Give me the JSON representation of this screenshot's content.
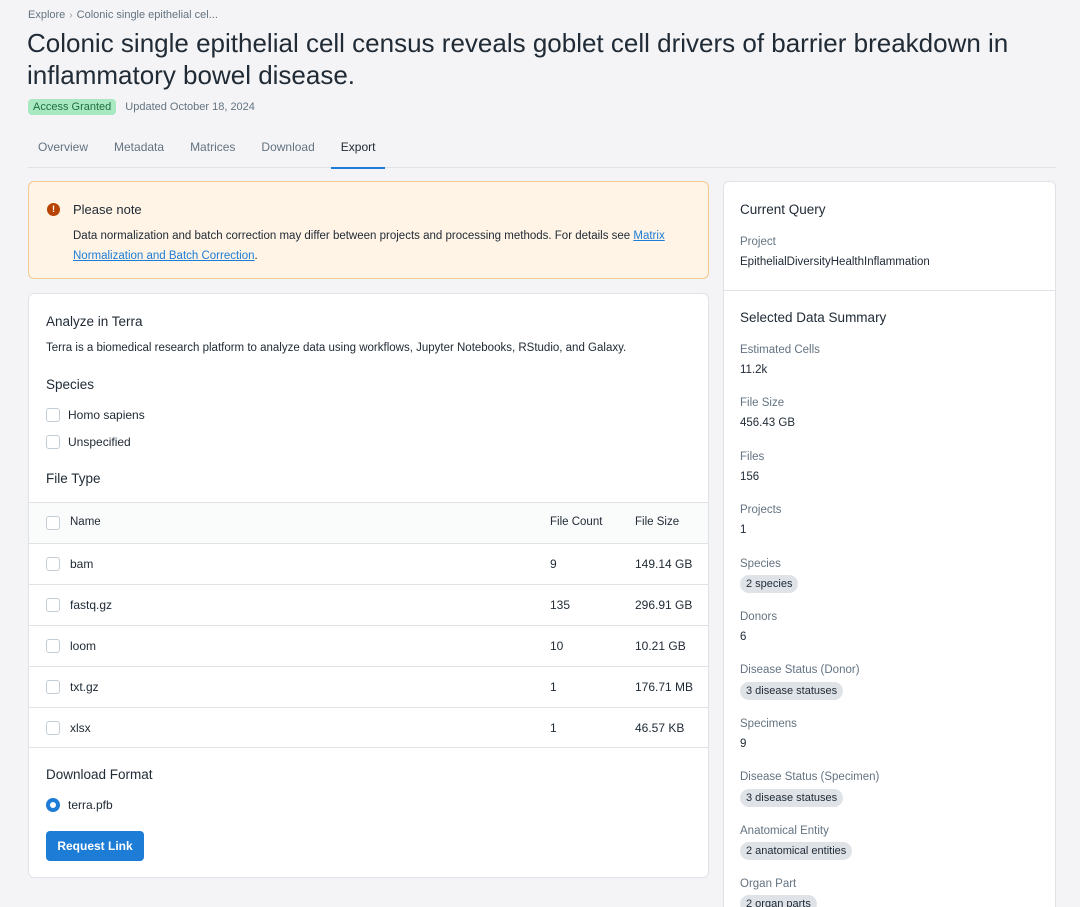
{
  "breadcrumb": {
    "root": "Explore",
    "separator": "›",
    "current": "Colonic single epithelial cel..."
  },
  "title": "Colonic single epithelial cell census reveals goblet cell drivers of barrier breakdown in inflammatory bowel disease.",
  "access_badge": "Access Granted",
  "updated": "Updated October 18, 2024",
  "tabs": [
    {
      "label": "Overview"
    },
    {
      "label": "Metadata"
    },
    {
      "label": "Matrices"
    },
    {
      "label": "Download"
    },
    {
      "label": "Export",
      "active": true
    }
  ],
  "alert": {
    "icon": "alert-circle-icon",
    "title": "Please note",
    "text": "Data normalization and batch correction may differ between projects and processing methods. For details see ",
    "link": "Matrix Normalization and Batch Correction",
    "suffix": "."
  },
  "analyze": {
    "heading": "Analyze in Terra",
    "description": "Terra is a biomedical research platform to analyze data using workflows, Jupyter Notebooks, RStudio, and Galaxy.",
    "species_heading": "Species",
    "species": [
      "Homo sapiens",
      "Unspecified"
    ],
    "file_type_heading": "File Type",
    "table": {
      "headers": {
        "name": "Name",
        "count": "File Count",
        "size": "File Size"
      },
      "rows": [
        {
          "name": "bam",
          "count": "9",
          "size": "149.14 GB"
        },
        {
          "name": "fastq.gz",
          "count": "135",
          "size": "296.91 GB"
        },
        {
          "name": "loom",
          "count": "10",
          "size": "10.21 GB"
        },
        {
          "name": "txt.gz",
          "count": "1",
          "size": "176.71 MB"
        },
        {
          "name": "xlsx",
          "count": "1",
          "size": "46.57 KB"
        }
      ]
    },
    "format_heading": "Download Format",
    "format_option": "terra.pfb",
    "request_button": "Request Link"
  },
  "current_query": {
    "heading": "Current Query",
    "project_label": "Project",
    "project_value": "EpithelialDiversityHealthInflammation"
  },
  "summary": {
    "heading": "Selected Data Summary",
    "items": [
      {
        "label": "Estimated Cells",
        "value": "11.2k"
      },
      {
        "label": "File Size",
        "value": "456.43 GB"
      },
      {
        "label": "Files",
        "value": "156"
      },
      {
        "label": "Projects",
        "value": "1"
      },
      {
        "label": "Species",
        "chip": "2 species"
      },
      {
        "label": "Donors",
        "value": "6"
      },
      {
        "label": "Disease Status (Donor)",
        "chip": "3 disease statuses"
      },
      {
        "label": "Specimens",
        "value": "9"
      },
      {
        "label": "Disease Status (Specimen)",
        "chip": "3 disease statuses"
      },
      {
        "label": "Anatomical Entity",
        "chip": "2 anatomical entities"
      },
      {
        "label": "Organ Part",
        "chip": "2 organ parts"
      }
    ]
  },
  "colors": {
    "accent": "#1c7cd6",
    "alert_bg": "#fff4e5",
    "alert_icon": "#b84300",
    "badge_bg": "#a9e9c2",
    "badge_text": "#1f6e3e"
  }
}
